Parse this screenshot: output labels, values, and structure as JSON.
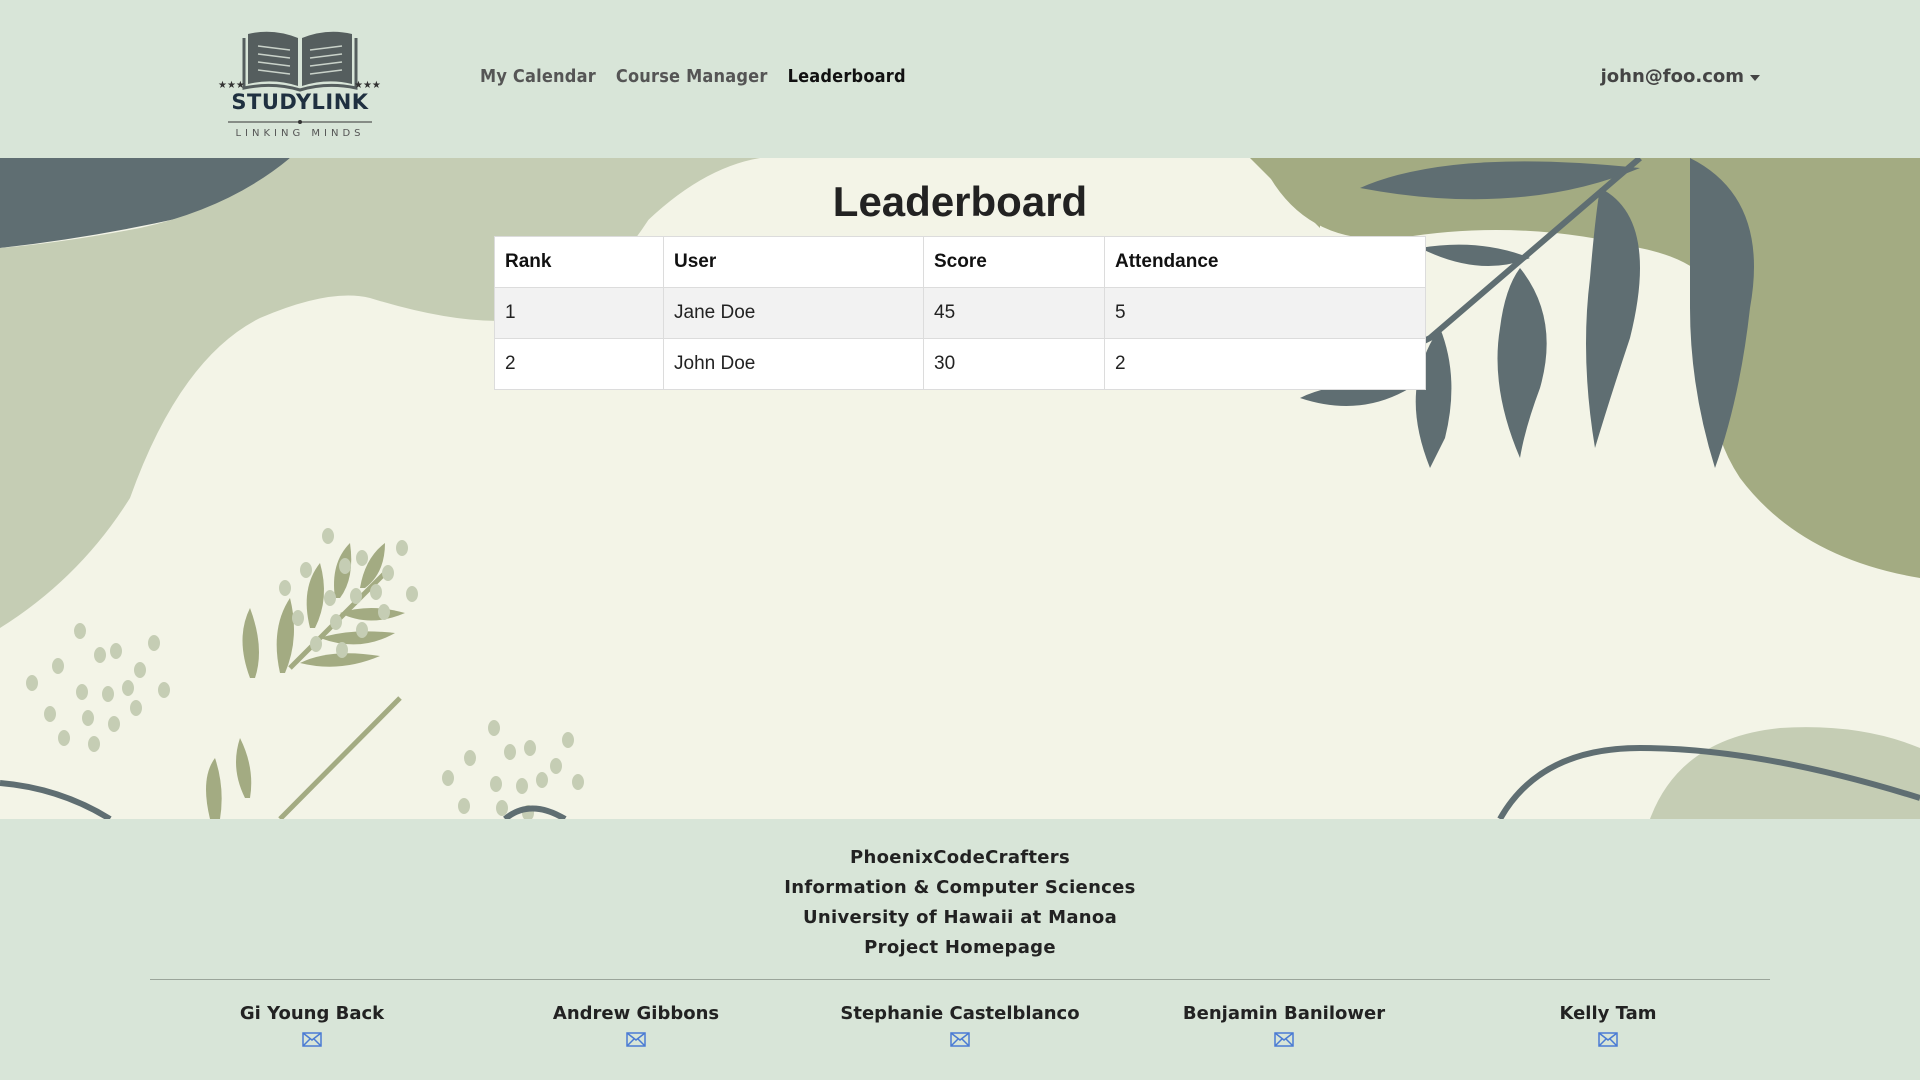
{
  "brand": {
    "name": "STUDYLINK",
    "tagline": "LINKING MINDS"
  },
  "nav": {
    "links": [
      {
        "label": "My Calendar",
        "active": false
      },
      {
        "label": "Course Manager",
        "active": false
      },
      {
        "label": "Leaderboard",
        "active": true
      }
    ],
    "user": "john@foo.com"
  },
  "page": {
    "title": "Leaderboard"
  },
  "table": {
    "headers": [
      "Rank",
      "User",
      "Score",
      "Attendance"
    ],
    "rows": [
      [
        "1",
        "Jane Doe",
        "45",
        "5"
      ],
      [
        "2",
        "John Doe",
        "30",
        "2"
      ]
    ]
  },
  "footer": {
    "lines": [
      "PhoenixCodeCrafters",
      "Information & Computer Sciences",
      "University of Hawaii at Manoa",
      "Project Homepage"
    ],
    "team": [
      "Gi Young Back",
      "Andrew Gibbons",
      "Stephanie Castelblanco",
      "Benjamin Banilower",
      "Kelly Tam"
    ]
  },
  "colors": {
    "navbar_bg": "#d8e5d8",
    "page_bg": "#f3f4e7",
    "leaf_dark": "#5f6e72",
    "leaf_olive": "#a3ab82",
    "leaf_sage": "#c5cdb4",
    "mail_icon": "#4a7bd4"
  }
}
